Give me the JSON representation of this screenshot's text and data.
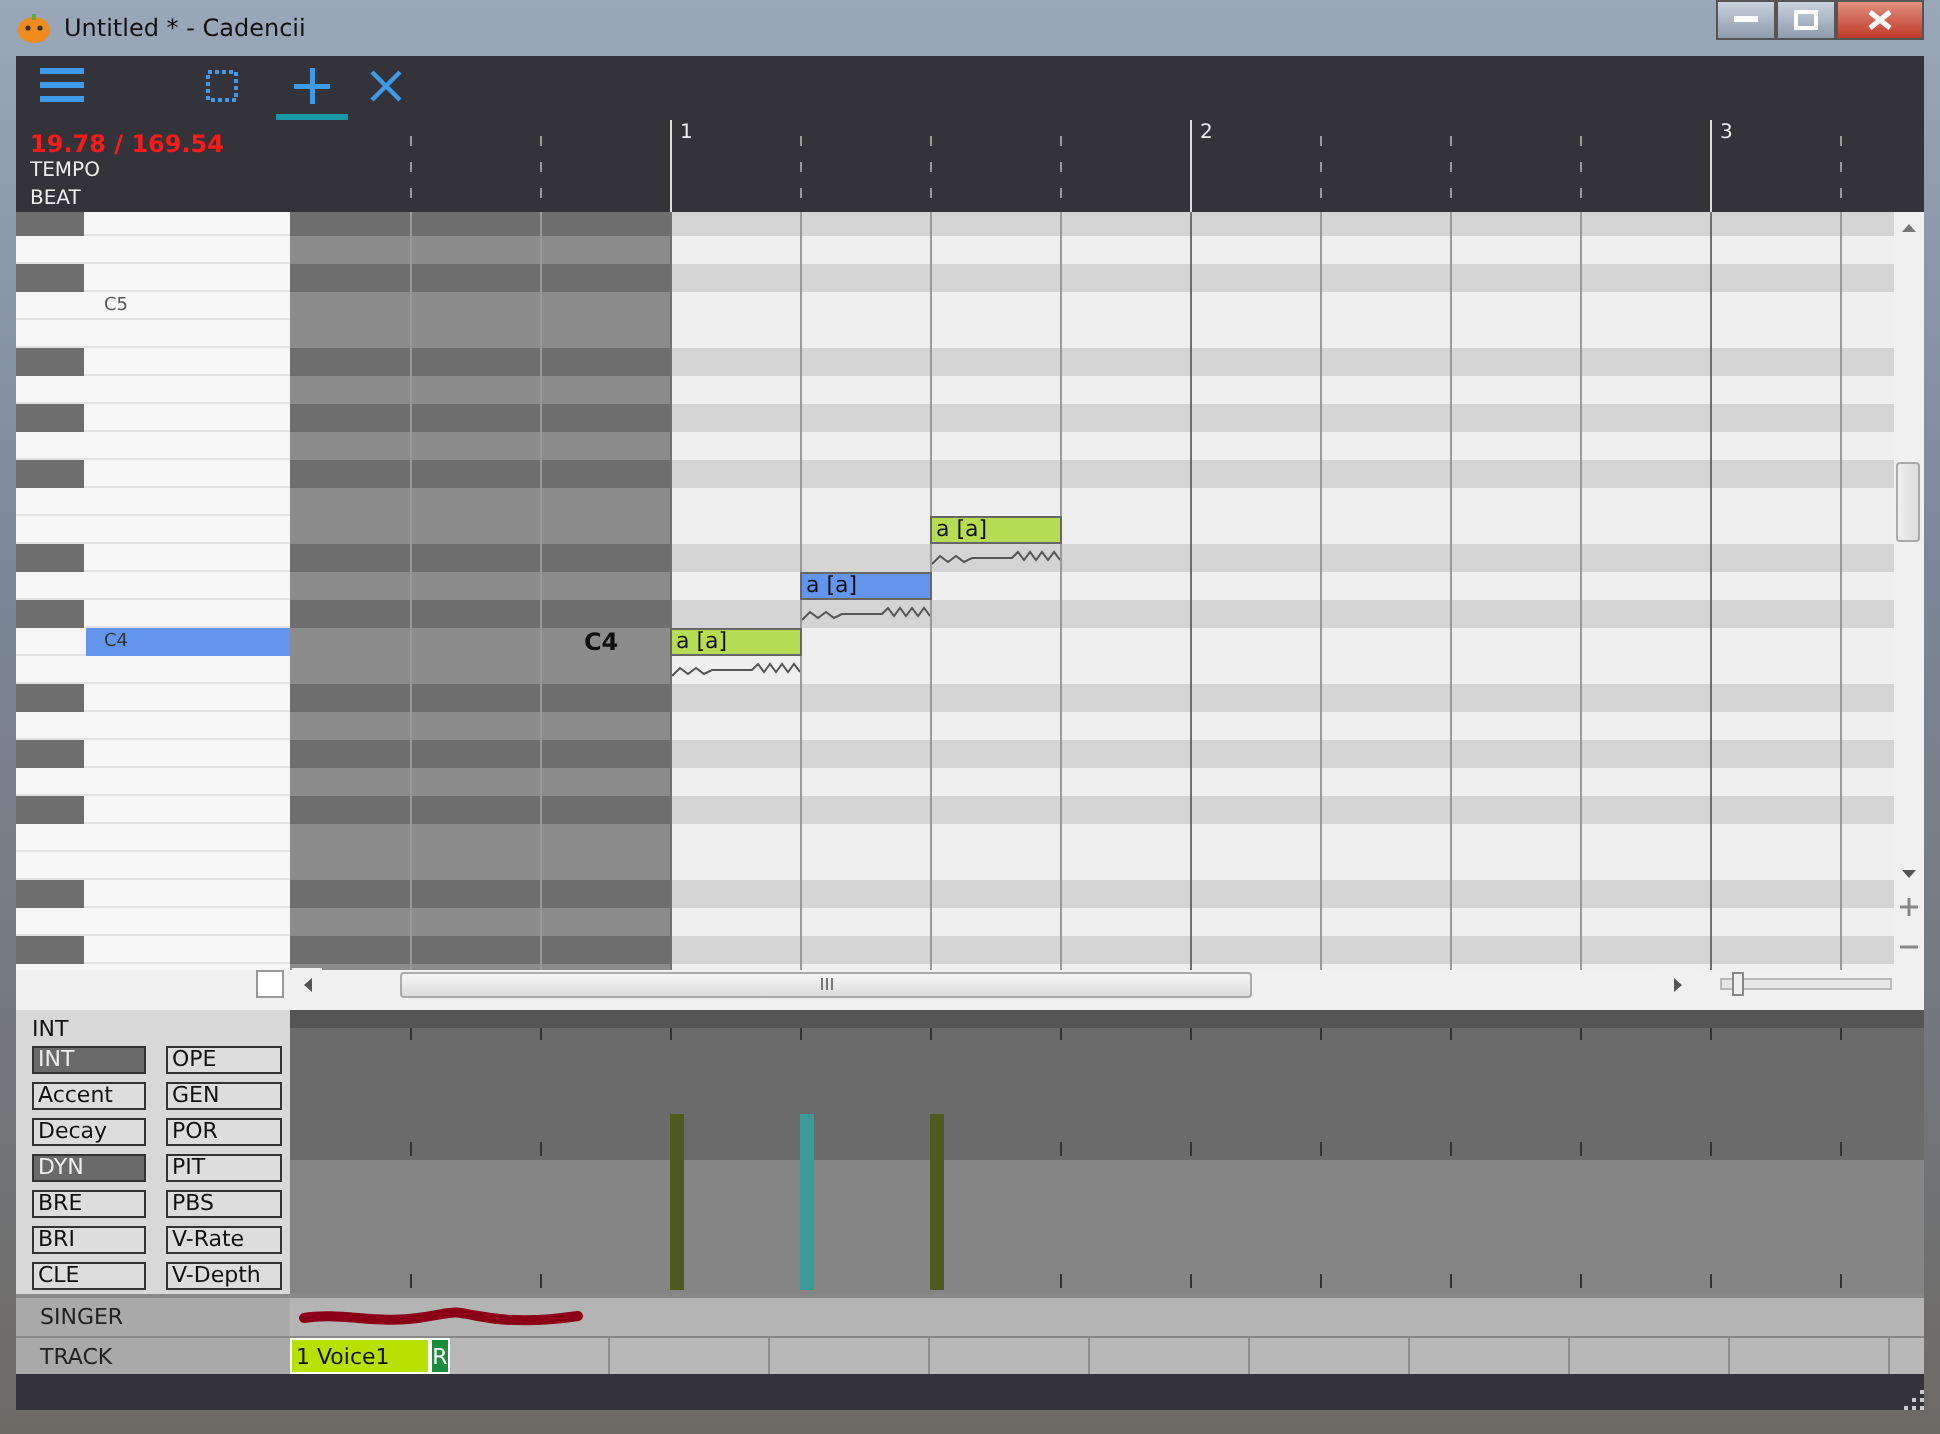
{
  "window": {
    "title": "Untitled * - Cadencii"
  },
  "toolbar": {
    "tools": [
      {
        "kind": "menu",
        "selected": false
      },
      {
        "kind": "select",
        "selected": false
      },
      {
        "kind": "pencil",
        "selected": true
      },
      {
        "kind": "eraser",
        "selected": false
      }
    ]
  },
  "ruler": {
    "time": "19.78 / 169.54",
    "labels": [
      "TEMPO",
      "BEAT"
    ],
    "measures": [
      "1",
      "2",
      "3"
    ]
  },
  "keyboard": {
    "octave_labels": [
      {
        "label": "C5",
        "selected": false
      },
      {
        "label": "C4",
        "selected": true
      }
    ]
  },
  "piano_roll": {
    "cursor_label": "C4",
    "notes": [
      {
        "lyric": "a [a]",
        "selected": false
      },
      {
        "lyric": "a [a]",
        "selected": true
      },
      {
        "lyric": "a [a]",
        "selected": false
      }
    ]
  },
  "roll_controls": {
    "checkbox": {
      "checked": false
    },
    "zoom": {
      "level": 0.08
    }
  },
  "curve_panel": {
    "title": "INT",
    "buttons": [
      {
        "label": "INT",
        "selected": true
      },
      {
        "label": "OPE",
        "selected": false
      },
      {
        "label": "Accent",
        "selected": false
      },
      {
        "label": "GEN",
        "selected": false
      },
      {
        "label": "Decay",
        "selected": false
      },
      {
        "label": "POR",
        "selected": false
      },
      {
        "label": "DYN",
        "selected": true
      },
      {
        "label": "PIT",
        "selected": false
      },
      {
        "label": "BRE",
        "selected": false
      },
      {
        "label": "PBS",
        "selected": false
      },
      {
        "label": "BRI",
        "selected": false
      },
      {
        "label": "V-Rate",
        "selected": false
      },
      {
        "label": "CLE",
        "selected": false
      },
      {
        "label": "V-Depth",
        "selected": false
      }
    ]
  },
  "singer_row": {
    "label": "SINGER"
  },
  "track_row": {
    "label": "TRACK",
    "tracks": [
      {
        "name": "1 Voice1",
        "badge": "R"
      }
    ]
  }
}
